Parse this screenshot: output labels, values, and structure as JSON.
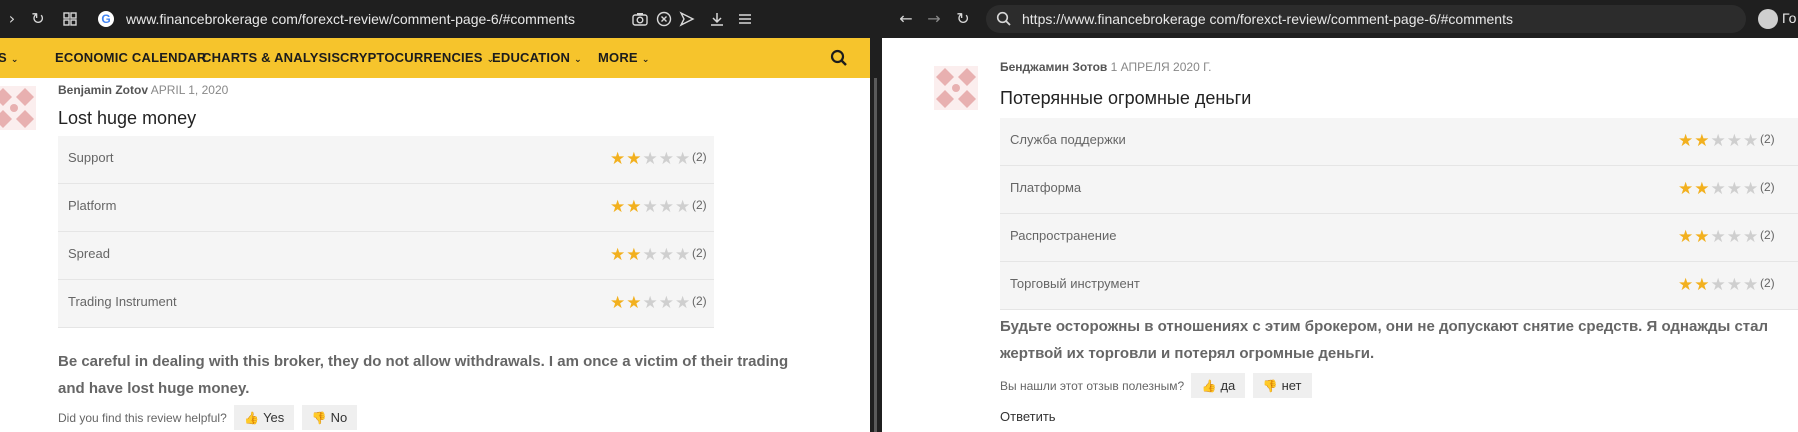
{
  "left": {
    "url": "www.financebrokerage com/forexct-review/comment-page-6/#comments",
    "nav": [
      {
        "label": "S"
      },
      {
        "label": "ECONOMIC CALENDAR"
      },
      {
        "label": "CHARTS & ANALYSIS"
      },
      {
        "label": "CRYPTOCURRENCIES"
      },
      {
        "label": "EDUCATION"
      },
      {
        "label": "MORE"
      }
    ],
    "review": {
      "author": "Benjamin Zotov",
      "date": "APRIL 1, 2020",
      "title": "Lost huge money",
      "ratings": [
        {
          "label": "Support",
          "stars": 2,
          "count": "(2)"
        },
        {
          "label": "Platform",
          "stars": 2,
          "count": "(2)"
        },
        {
          "label": "Spread",
          "stars": 2,
          "count": "(2)"
        },
        {
          "label": "Trading Instrument",
          "stars": 2,
          "count": "(2)"
        }
      ],
      "body_line1": "Be careful in dealing with this broker, they do not allow withdrawals. I am once a victim of their trading",
      "body_line2": "and have lost huge money.",
      "helpful_question": "Did you find this review helpful?",
      "yes_label": "Yes",
      "no_label": "No"
    }
  },
  "right": {
    "url": "https://www.financebrokerage com/forexct-review/comment-page-6/#comments",
    "profile_text": "Го",
    "review": {
      "author": "Бенджамин Зотов",
      "date": "1 АПРЕЛЯ 2020 Г.",
      "title": "Потерянные огромные деньги",
      "ratings": [
        {
          "label": "Служба поддержки",
          "stars": 2,
          "count": "(2)"
        },
        {
          "label": "Платформа",
          "stars": 2,
          "count": "(2)"
        },
        {
          "label": "Распространение",
          "stars": 2,
          "count": "(2)"
        },
        {
          "label": "Торговый инструмент",
          "stars": 2,
          "count": "(2)"
        }
      ],
      "body_line1": "Будьте осторожны в отношениях с этим брокером, они не допускают снятие средств. Я однажды стал",
      "body_line2": "жертвой их торговли и потерял огромные деньги.",
      "helpful_question": "Вы нашли этот отзыв полезным?",
      "yes_label": "да",
      "no_label": "нет",
      "reply_label": "Ответить"
    }
  },
  "colors": {
    "nav_bg": "#f6c42c",
    "star_on": "#f2b01e",
    "star_off": "#cfcfcf",
    "chrome_bg": "#1f1f1f"
  },
  "icons": [
    "chevron-right-icon",
    "reload-icon",
    "tabs-grid-icon",
    "google-g-icon",
    "camera-icon",
    "shield-block-icon",
    "send-icon",
    "download-icon",
    "menu-icon",
    "back-arrow-icon",
    "forward-arrow-icon",
    "search-icon",
    "profile-icon",
    "thumbs-up-icon",
    "thumbs-down-icon"
  ]
}
